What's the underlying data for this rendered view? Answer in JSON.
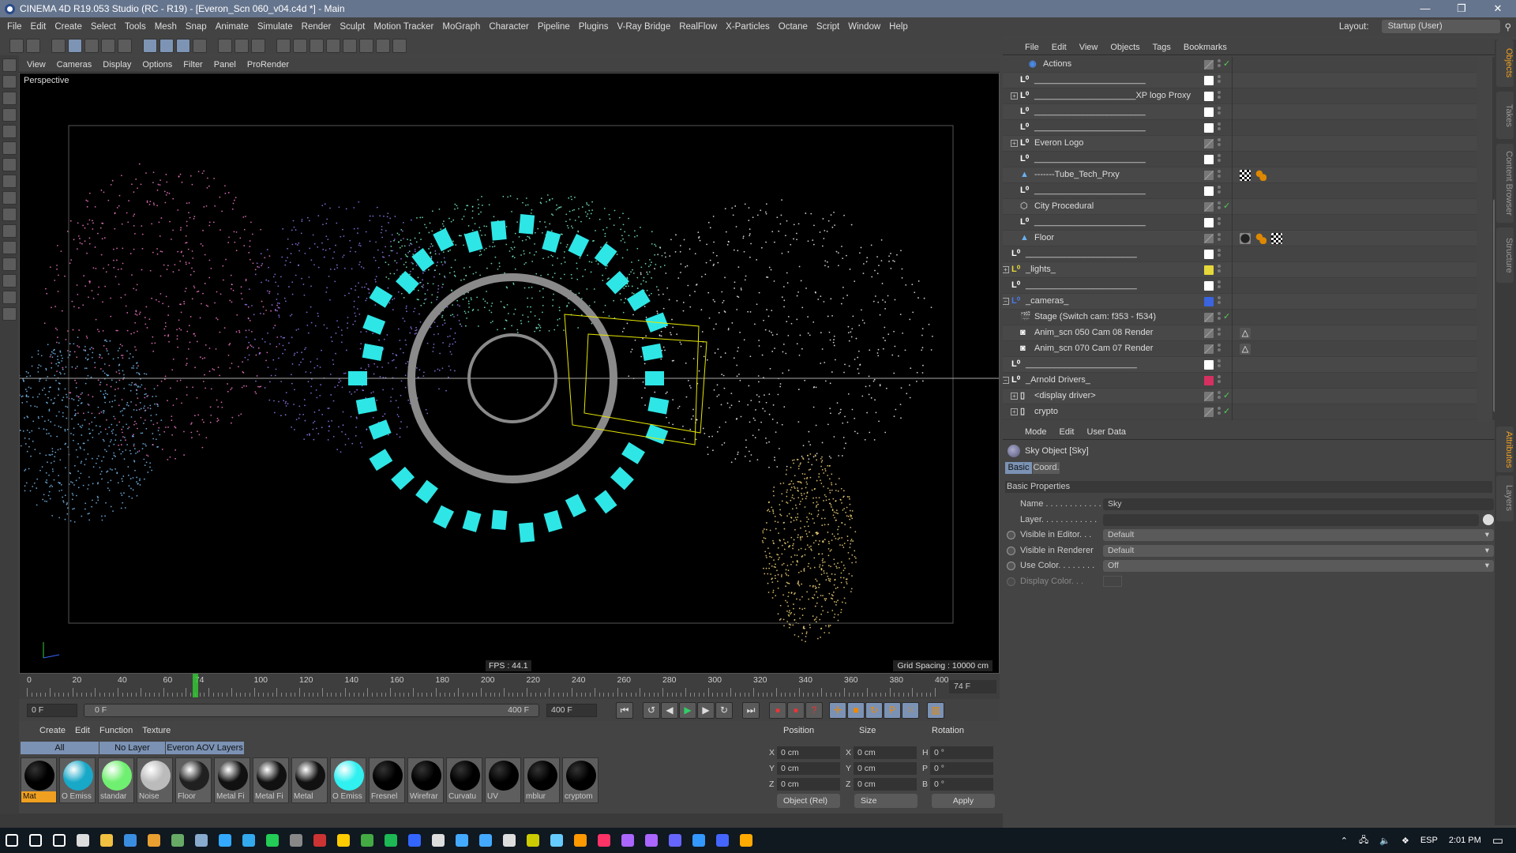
{
  "window": {
    "title": "CINEMA 4D R19.053 Studio (RC - R19) - [Everon_Scn 060_v04.c4d *] - Main",
    "minimize": "—",
    "restore": "❐",
    "close": "✕"
  },
  "menu": [
    "File",
    "Edit",
    "Create",
    "Select",
    "Tools",
    "Mesh",
    "Snap",
    "Animate",
    "Simulate",
    "Render",
    "Sculpt",
    "Motion Tracker",
    "MoGraph",
    "Character",
    "Pipeline",
    "Plugins",
    "V-Ray Bridge",
    "RealFlow",
    "X-Particles",
    "Octane",
    "Script",
    "Window",
    "Help"
  ],
  "layout": {
    "label": "Layout:",
    "value": "Startup (User)"
  },
  "viewport": {
    "menu": [
      "View",
      "Cameras",
      "Display",
      "Options",
      "Filter",
      "Panel",
      "ProRender"
    ],
    "camera": "Perspective",
    "fps": "FPS : 44.1",
    "grid": "Grid Spacing : 10000 cm",
    "colors": {
      "particles": [
        "#ff7fd0",
        "#9f7fff",
        "#7fffd0",
        "#ffffff",
        "#ffe07f",
        "#7fc8ff"
      ],
      "blocks": "#2ee6e6",
      "ring": "#8a8a8a",
      "cage": "#e6e600"
    }
  },
  "timeline": {
    "ticks": [
      "0",
      "20",
      "40",
      "60",
      "74",
      "100",
      "120",
      "140",
      "160",
      "180",
      "200",
      "220",
      "240",
      "260",
      "280",
      "300",
      "320",
      "340",
      "360",
      "380",
      "400"
    ],
    "current_frame": 74,
    "current_label": "74 F",
    "start": "0 F",
    "range_start": "0 F",
    "range_end": "400 F",
    "end": "400 F"
  },
  "materials": {
    "menu": [
      "Create",
      "Edit",
      "Function",
      "Texture"
    ],
    "tabs": [
      "All",
      "No Layer",
      "Everon AOV Layers"
    ],
    "items": [
      {
        "label": "Mat",
        "color": "#000000"
      },
      {
        "label": "O Emiss",
        "color": "#18a8c8"
      },
      {
        "label": "standar",
        "color": "#70f070"
      },
      {
        "label": "Noise",
        "color": "#bbbbbb"
      },
      {
        "label": "Floor",
        "color": "#202020"
      },
      {
        "label": "Metal Fi",
        "color": "#111111"
      },
      {
        "label": "Metal Fi",
        "color": "#111111"
      },
      {
        "label": "Metal",
        "color": "#111111"
      },
      {
        "label": "O Emiss",
        "color": "#30f0f0"
      },
      {
        "label": "Fresnel",
        "color": "#000000"
      },
      {
        "label": "Wirefrar",
        "color": "#000000"
      },
      {
        "label": "Curvatu",
        "color": "#000000"
      },
      {
        "label": "UV",
        "color": "#000000"
      },
      {
        "label": "mblur",
        "color": "#000000"
      },
      {
        "label": "cryptom",
        "color": "#000000"
      }
    ]
  },
  "coords": {
    "headers": [
      "Position",
      "Size",
      "Rotation"
    ],
    "rows": [
      {
        "a": "X",
        "v": "0 cm",
        "b": "X",
        "s": "0 cm",
        "c": "H",
        "r": "0 °"
      },
      {
        "a": "Y",
        "v": "0 cm",
        "b": "Y",
        "s": "0 cm",
        "c": "P",
        "r": "0 °"
      },
      {
        "a": "Z",
        "v": "0 cm",
        "b": "Z",
        "s": "0 cm",
        "c": "B",
        "r": "0 °"
      }
    ],
    "mode": "Object (Rel)",
    "size_mode": "Size",
    "apply": "Apply"
  },
  "objects": {
    "menu": [
      "File",
      "Edit",
      "View",
      "Objects",
      "Tags",
      "Bookmarks"
    ],
    "rows": [
      {
        "name": "Actions",
        "icon": "actions",
        "indent": 3,
        "exp": "",
        "sw": "edit",
        "chk": true
      },
      {
        "name": "_______________________",
        "icon": "null",
        "indent": 2,
        "exp": "",
        "sw": "#ffffff"
      },
      {
        "name": "_____________________XP logo Proxy",
        "icon": "null",
        "indent": 2,
        "exp": "+",
        "sw": "#ffffff"
      },
      {
        "name": "_______________________",
        "icon": "null",
        "indent": 2,
        "exp": "",
        "sw": "#ffffff"
      },
      {
        "name": "_______________________",
        "icon": "null",
        "indent": 2,
        "exp": "",
        "sw": "#ffffff"
      },
      {
        "name": "Everon Logo",
        "icon": "null",
        "indent": 2,
        "exp": "+",
        "sw": "edit"
      },
      {
        "name": "_______________________",
        "icon": "null",
        "indent": 2,
        "exp": "",
        "sw": "#ffffff"
      },
      {
        "name": "-------Tube_Tech_Prxy",
        "icon": "xp",
        "indent": 2,
        "exp": "",
        "sw": "edit",
        "tags": [
          "checker",
          "dots"
        ]
      },
      {
        "name": "_______________________",
        "icon": "null",
        "indent": 2,
        "exp": "",
        "sw": "#ffffff"
      },
      {
        "name": "City Procedural",
        "icon": "cube",
        "indent": 2,
        "exp": "",
        "sw": "edit",
        "chk": true
      },
      {
        "name": "_______________________",
        "icon": "null",
        "indent": 2,
        "exp": "",
        "sw": "#ffffff"
      },
      {
        "name": "Floor",
        "icon": "xp",
        "indent": 2,
        "exp": "",
        "sw": "edit",
        "tags": [
          "material",
          "dots",
          "checker"
        ]
      },
      {
        "name": "_______________________",
        "icon": "null",
        "indent": 1,
        "exp": "",
        "sw": "#ffffff"
      },
      {
        "name": "_lights_",
        "icon": "null-yellow",
        "indent": 1,
        "exp": "+",
        "sw": "#e6d83a"
      },
      {
        "name": "_______________________",
        "icon": "null",
        "indent": 1,
        "exp": "",
        "sw": "#ffffff"
      },
      {
        "name": "_cameras_",
        "icon": "null-blue",
        "indent": 1,
        "exp": "−",
        "sw": "#3a64e0"
      },
      {
        "name": "Stage (Switch cam: f353 - f534)",
        "icon": "stage",
        "indent": 2,
        "exp": "",
        "sw": "edit",
        "chk": true
      },
      {
        "name": "Anim_scn 050 Cam 08 Render",
        "icon": "camera",
        "indent": 2,
        "exp": "",
        "sw": "edit",
        "tags": [
          "target"
        ]
      },
      {
        "name": "Anim_scn 070 Cam 07 Render",
        "icon": "camera",
        "indent": 2,
        "exp": "",
        "sw": "edit",
        "tags": [
          "target"
        ]
      },
      {
        "name": "_______________________",
        "icon": "null",
        "indent": 1,
        "exp": "",
        "sw": "#ffffff"
      },
      {
        "name": "_Arnold Drivers_",
        "icon": "null",
        "indent": 1,
        "exp": "−",
        "sw": "#d63060"
      },
      {
        "name": "<display driver>",
        "icon": "doc",
        "indent": 2,
        "exp": "+",
        "sw": "edit",
        "chk": true
      },
      {
        "name": "crypto",
        "icon": "doc",
        "indent": 2,
        "exp": "+",
        "sw": "edit",
        "chk": true
      }
    ]
  },
  "attributes": {
    "menu": [
      "Mode",
      "Edit",
      "User Data"
    ],
    "object": "Sky Object [Sky]",
    "tabs": [
      "Basic",
      "Coord."
    ],
    "section": "Basic Properties",
    "fields": [
      {
        "label": "Name . . . . . . . . . . . .",
        "value": "Sky",
        "type": "text",
        "radio": false
      },
      {
        "label": "Layer. . . . . . . . . . . .",
        "value": "",
        "type": "link",
        "radio": false
      },
      {
        "label": "Visible in Editor. . .",
        "value": "Default",
        "type": "dd",
        "radio": true
      },
      {
        "label": "Visible in Renderer",
        "value": "Default",
        "type": "dd",
        "radio": true
      },
      {
        "label": "Use Color. . . . . . . .",
        "value": "Off",
        "type": "dd",
        "radio": true
      },
      {
        "label": "Display Color. . .",
        "value": "",
        "type": "color",
        "radio": true
      }
    ]
  },
  "side_tabs": {
    "top": [
      "Objects",
      "Takes",
      "Content Browser",
      "Structure"
    ],
    "bottom": [
      "Attributes",
      "Layers"
    ]
  },
  "taskbar": {
    "lang": "ESP",
    "time": "2:01 PM"
  }
}
